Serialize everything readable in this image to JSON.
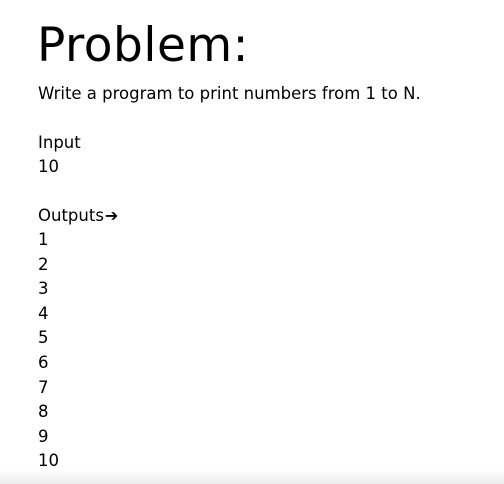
{
  "slide": {
    "title": "Problem:",
    "statement": "Write a program to print numbers from 1 to N.",
    "input": {
      "label": "Input",
      "value": "10"
    },
    "outputs": {
      "label": "Outputs",
      "arrow": "➔",
      "values": [
        "1",
        "2",
        "3",
        "4",
        "5",
        "6",
        "7",
        "8",
        "9",
        "10"
      ]
    }
  }
}
